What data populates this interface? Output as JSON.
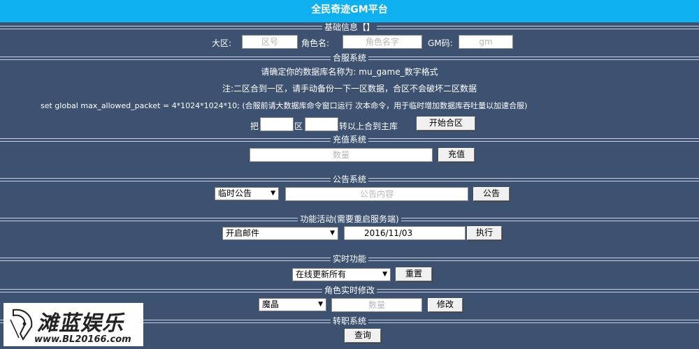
{
  "app": {
    "title": "全民奇迹GM平台"
  },
  "basic": {
    "title": "基础信息【】",
    "zone_label": "大区:",
    "zone_placeholder": "区号",
    "role_label": "角色名:",
    "role_placeholder": "角色名字",
    "gm_label": "GM码:",
    "gm_placeholder": "gm"
  },
  "merge": {
    "title": "合服系统",
    "hint1": "请确定你的数据库名称为: mu_game_数字格式",
    "hint2": "注:二区合到一区，请手动备份一下一区数据，合区不会破坏二区数据",
    "sql": "set global max_allowed_packet = 4*1024*1024*10; (合服前请大数据库命令窗口运行  次本命令，用于临时增加数据库吞吐量以加速合服)",
    "ba": "把",
    "qu": "区",
    "tail": "转以上合到主库",
    "button": "开始合区"
  },
  "recharge": {
    "title": "充值系统",
    "placeholder": "数量",
    "button": "充值"
  },
  "notice": {
    "title": "公告系统",
    "type_selected": "临时公告",
    "placeholder": "公告内容",
    "button": "公告"
  },
  "activity": {
    "title": "功能活动(需要重启服务端)",
    "selected": "开启邮件",
    "date": "2016/11/03",
    "button": "执行"
  },
  "realtime": {
    "title": "实时功能",
    "selected": "在线更新所有",
    "button": "重置"
  },
  "role_edit": {
    "title": "角色实时修改",
    "selected": "魔晶",
    "placeholder": "数量",
    "button": "修改"
  },
  "transfer": {
    "title": "转职系统",
    "button": "查询"
  },
  "watermark": {
    "brand": "滩蓝娱乐",
    "url": "www.BL20166.com"
  },
  "colors": {
    "background": "#3d5270",
    "title_bar": "#0fb0f0"
  }
}
